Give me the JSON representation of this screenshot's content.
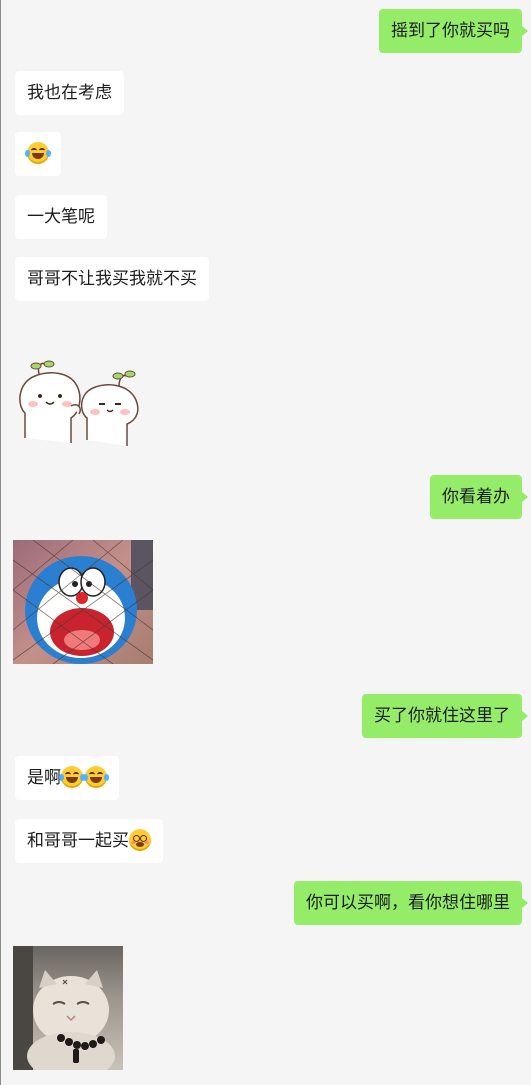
{
  "messages": [
    {
      "side": "out",
      "text": "摇到了你就买吗"
    },
    {
      "side": "in",
      "text": "我也在考虑"
    },
    {
      "side": "in",
      "emoji": "face-with-tears-of-joy"
    },
    {
      "side": "in",
      "text": "一大笔呢"
    },
    {
      "side": "in",
      "text": "哥哥不让我买我就不买"
    },
    {
      "side": "in",
      "sticker": "two-cartoon-buns-sticker"
    },
    {
      "side": "out",
      "text": "你看着办"
    },
    {
      "side": "in",
      "image": "doraemon-in-net-image"
    },
    {
      "side": "out",
      "text": "买了你就住这里了"
    },
    {
      "side": "in",
      "text": "是啊",
      "emoji": [
        "face-with-tears-of-joy",
        "face-with-tears-of-joy"
      ]
    },
    {
      "side": "in",
      "text": "和哥哥一起买",
      "emoji": [
        "woozy-face"
      ]
    },
    {
      "side": "out",
      "text": "你可以买啊，看你想住哪里"
    },
    {
      "side": "in",
      "image": "cat-with-prayer-beads-image"
    }
  ],
  "colors": {
    "background": "#f5f5f5",
    "incoming_bubble": "#ffffff",
    "outgoing_bubble": "#95ec69",
    "text": "#1c1c1c"
  }
}
